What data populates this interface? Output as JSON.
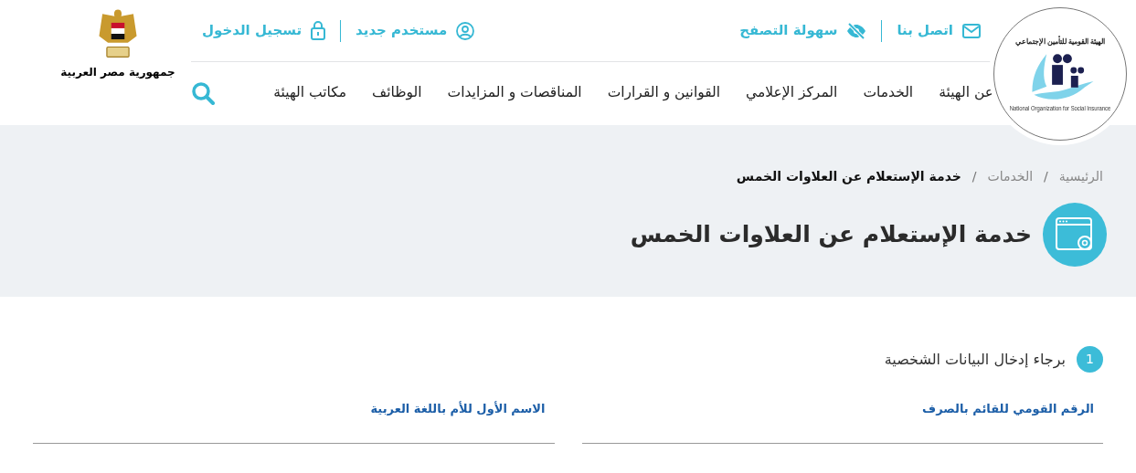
{
  "logo": {
    "arabic": "الهيئة القومية للتأمين الإجتماعي",
    "english": "National Organization for Social Insurance"
  },
  "utility_links": [
    {
      "label": "اتصل بنا"
    },
    {
      "label": "سهولة التصفح"
    },
    {
      "label": "مستخدم جديد"
    },
    {
      "label": "تسجيل الدخول"
    }
  ],
  "nav": [
    {
      "label": "عن الهيئة"
    },
    {
      "label": "الخدمات"
    },
    {
      "label": "المركز الإعلامي"
    },
    {
      "label": "القوانين و القرارات"
    },
    {
      "label": "المناقصات و المزايدات"
    },
    {
      "label": "الوظائف"
    },
    {
      "label": "مكاتب الهيئة"
    }
  ],
  "emblem": {
    "caption": "جمهورية مصر العربية"
  },
  "breadcrumb": {
    "separator": "/",
    "items": [
      {
        "label": "الرئيسية",
        "current": false
      },
      {
        "label": "الخدمات",
        "current": false
      },
      {
        "label": "خدمة الإستعلام عن العلاوات الخمس",
        "current": true
      }
    ]
  },
  "page_title": "خدمة الإستعلام عن العلاوات الخمس",
  "steps": [
    {
      "number": "1",
      "label": "برجاء إدخال البيانات الشخصية",
      "fields": [
        {
          "label": "الرقم القومي للقائم بالصرف"
        },
        {
          "label": "الاسم الأول للأم باللغة العربية"
        }
      ]
    }
  ]
}
